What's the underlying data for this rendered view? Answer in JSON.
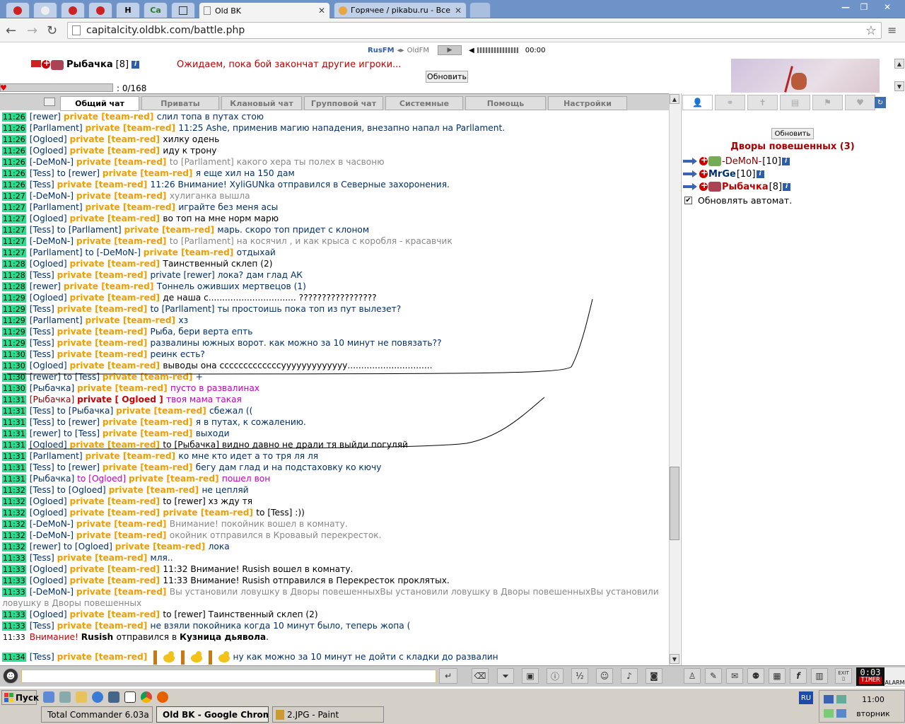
{
  "browser": {
    "tabs": [
      {
        "title": "Old BK",
        "active": true
      },
      {
        "title": "Горячее / pikabu.ru - Все",
        "active": false
      }
    ],
    "pinned_tabs": [
      "",
      "",
      "",
      "",
      "H",
      "Ca",
      ""
    ],
    "url": "capitalcity.oldbk.com/battle.php"
  },
  "radio": {
    "station1": "RusFM",
    "station2": "OldFM",
    "time": "00:00"
  },
  "header": {
    "player_name": "Рыбачка",
    "player_level": "[8]",
    "wait_message": "Ожидаем, пока бой закончат другие игроки...",
    "refresh_label": "Обновить",
    "hp": "0/168",
    "hp_fraction": 0
  },
  "chat_tabs": [
    "Общий чат",
    "Приваты",
    "Клановый чат",
    "Групповой чат",
    "Системные",
    "Помощь",
    "Настройки"
  ],
  "chat_lines": [
    {
      "t": "11:26",
      "segs": [
        [
          "[rewer] ",
          "nm"
        ],
        [
          "private [team-red] ",
          "pv"
        ],
        [
          "слил топа в путах стою",
          "c-blue"
        ]
      ]
    },
    {
      "t": "11:26",
      "segs": [
        [
          "[Parllament] ",
          "nm"
        ],
        [
          "private [team-red] ",
          "pv"
        ],
        [
          "11:25 Ashe, применив магию нападения, внезапно напал на Parllament.",
          "c-blue"
        ]
      ]
    },
    {
      "t": "11:26",
      "segs": [
        [
          "[Ogloed] ",
          "nm"
        ],
        [
          "private [team-red] ",
          "pv"
        ],
        [
          "хилку одень",
          "c-black"
        ]
      ]
    },
    {
      "t": "11:26",
      "segs": [
        [
          "[Ogloed] ",
          "nm"
        ],
        [
          "private [team-red] ",
          "pv"
        ],
        [
          "иду к трону",
          "c-black"
        ]
      ]
    },
    {
      "t": "11:26",
      "segs": [
        [
          "[-DeMoN-] ",
          "nm"
        ],
        [
          "private [team-red] ",
          "pv"
        ],
        [
          "to [Parllament] какого хера ты полех в часвоню",
          "c-gray"
        ]
      ]
    },
    {
      "t": "11:26",
      "segs": [
        [
          "[Tess] ",
          "nm"
        ],
        [
          "to [rewer] ",
          "to"
        ],
        [
          "private [team-red] ",
          "pv"
        ],
        [
          "я еще хил на 150 дам",
          "c-blue"
        ]
      ]
    },
    {
      "t": "11:26",
      "segs": [
        [
          "[Tess] ",
          "nm"
        ],
        [
          "private [team-red] ",
          "pv"
        ],
        [
          "11:26 Внимание! XyliGUNka отправился в Северные захоронения.",
          "c-blue"
        ]
      ]
    },
    {
      "t": "11:27",
      "segs": [
        [
          "[-DeMoN-] ",
          "nm"
        ],
        [
          "private [team-red] ",
          "pv"
        ],
        [
          "хулиганка вышла",
          "c-gray"
        ]
      ]
    },
    {
      "t": "11:27",
      "segs": [
        [
          "[Parllament] ",
          "nm"
        ],
        [
          "private [team-red] ",
          "pv"
        ],
        [
          "играйте без меня асы",
          "c-blue"
        ]
      ]
    },
    {
      "t": "11:27",
      "segs": [
        [
          "[Ogloed] ",
          "nm"
        ],
        [
          "private [team-red] ",
          "pv"
        ],
        [
          "во топ на мне норм марю",
          "c-black"
        ]
      ]
    },
    {
      "t": "11:27",
      "segs": [
        [
          "[Tess] ",
          "nm"
        ],
        [
          "to [Parllament] ",
          "to"
        ],
        [
          "private [team-red] ",
          "pv"
        ],
        [
          "марь. скоро топ придет с клоном",
          "c-blue"
        ]
      ]
    },
    {
      "t": "11:27",
      "segs": [
        [
          "[-DeMoN-] ",
          "nm"
        ],
        [
          "private [team-red] ",
          "pv"
        ],
        [
          "to [Parllament] на косячил , и как крыса с коробля - красавчик",
          "c-gray"
        ]
      ]
    },
    {
      "t": "11:27",
      "segs": [
        [
          "[Parllament] ",
          "nm"
        ],
        [
          "to [-DeMoN-] ",
          "to"
        ],
        [
          "private [team-red] ",
          "pv"
        ],
        [
          "отдыхай",
          "c-blue"
        ]
      ]
    },
    {
      "t": "11:28",
      "segs": [
        [
          "[Ogloed] ",
          "nm"
        ],
        [
          "private [team-red] ",
          "pv"
        ],
        [
          "Таинственный склеп (2)",
          "c-black"
        ]
      ]
    },
    {
      "t": "11:28",
      "segs": [
        [
          "[Tess] ",
          "nm"
        ],
        [
          "private [team-red] ",
          "pv"
        ],
        [
          "private [rewer] лока? дам глад АК",
          "c-blue"
        ]
      ]
    },
    {
      "t": "11:28",
      "segs": [
        [
          "[rewer] ",
          "nm"
        ],
        [
          "private [team-red] ",
          "pv"
        ],
        [
          "Тоннель оживших мертвецов (1)",
          "c-blue"
        ]
      ]
    },
    {
      "t": "11:29",
      "segs": [
        [
          "[Ogloed] ",
          "nm"
        ],
        [
          "private [team-red] ",
          "pv"
        ],
        [
          "де наша с................................ ?????????????????",
          "c-black"
        ]
      ]
    },
    {
      "t": "11:29",
      "segs": [
        [
          "[Tess] ",
          "nm"
        ],
        [
          "private [team-red] ",
          "pv"
        ],
        [
          "to [Parllament] ты простоишь пока топ из пут вылезет?",
          "c-blue"
        ]
      ]
    },
    {
      "t": "11:29",
      "segs": [
        [
          "[Parllament] ",
          "nm"
        ],
        [
          "private [team-red] ",
          "pv"
        ],
        [
          "хз",
          "c-blue"
        ]
      ]
    },
    {
      "t": "11:29",
      "segs": [
        [
          "[Tess] ",
          "nm"
        ],
        [
          "private [team-red] ",
          "pv"
        ],
        [
          "Рыба, бери верта епть",
          "c-blue"
        ]
      ]
    },
    {
      "t": "11:29",
      "segs": [
        [
          "[Tess] ",
          "nm"
        ],
        [
          "private [team-red] ",
          "pv"
        ],
        [
          "развалины южных ворот. как можно за 10 минут не повязать??",
          "c-blue"
        ]
      ]
    },
    {
      "t": "11:30",
      "segs": [
        [
          "[Tess] ",
          "nm"
        ],
        [
          "private [team-red] ",
          "pv"
        ],
        [
          "реинк есть?",
          "c-blue"
        ]
      ]
    },
    {
      "t": "11:30",
      "segs": [
        [
          "[Ogloed] ",
          "nm"
        ],
        [
          "private [team-red] ",
          "pv"
        ],
        [
          "выводы она сссссссссссссууууууууууууу...............................",
          "c-black"
        ]
      ]
    },
    {
      "t": "11:30",
      "segs": [
        [
          "[rewer] ",
          "nm"
        ],
        [
          "to [Tess] ",
          "to"
        ],
        [
          "private [team-red] ",
          "pv"
        ],
        [
          "+",
          "c-blue"
        ]
      ]
    },
    {
      "t": "11:30",
      "segs": [
        [
          "[Рыбачка] ",
          "nm"
        ],
        [
          "private [team-red] ",
          "pv"
        ],
        [
          "пусто в развалинах",
          "c-pink"
        ]
      ]
    },
    {
      "t": "11:31",
      "segs": [
        [
          "[Рыбачка] ",
          "nmR"
        ],
        [
          "private [ Ogloed ] ",
          "pvR"
        ],
        [
          "твоя мама такая",
          "c-pink"
        ]
      ]
    },
    {
      "t": "11:31",
      "segs": [
        [
          "[Tess] ",
          "nm"
        ],
        [
          "to [Рыбачка] ",
          "to"
        ],
        [
          "private [team-red] ",
          "pv"
        ],
        [
          "сбежал ((",
          "c-blue"
        ]
      ]
    },
    {
      "t": "11:31",
      "segs": [
        [
          "[Tess] ",
          "nm"
        ],
        [
          "to [rewer] ",
          "to"
        ],
        [
          "private [team-red] ",
          "pv"
        ],
        [
          "я в путах, к сожалению.",
          "c-blue"
        ]
      ]
    },
    {
      "t": "11:31",
      "segs": [
        [
          "[rewer] ",
          "nm"
        ],
        [
          "to [Tess] ",
          "to"
        ],
        [
          "private [team-red] ",
          "pv"
        ],
        [
          "выходи",
          "c-blue"
        ]
      ]
    },
    {
      "t": "11:31",
      "segs": [
        [
          "[Ogloed] ",
          "nm"
        ],
        [
          "private [team-red] ",
          "pv"
        ],
        [
          "to [Рыбачка] видно давно не драли тя выйди погуляй",
          "c-black"
        ]
      ]
    },
    {
      "t": "11:31",
      "segs": [
        [
          "[Parllament] ",
          "nm"
        ],
        [
          "private [team-red] ",
          "pv"
        ],
        [
          "ко мне кто идет а то тря ля ля",
          "c-blue"
        ]
      ]
    },
    {
      "t": "11:31",
      "segs": [
        [
          "[Tess] ",
          "nm"
        ],
        [
          "to [rewer] ",
          "to"
        ],
        [
          "private [team-red] ",
          "pv"
        ],
        [
          "бегу дам глад и на подстаховку ко кючу",
          "c-blue"
        ]
      ]
    },
    {
      "t": "11:31",
      "segs": [
        [
          "[Рыбачка] ",
          "nm"
        ],
        [
          "to [Ogloed] ",
          "toP"
        ],
        [
          "private [team-red] ",
          "pv"
        ],
        [
          "пошел вон",
          "c-pink"
        ]
      ]
    },
    {
      "t": "11:32",
      "segs": [
        [
          "[Tess] ",
          "nm"
        ],
        [
          "to [Ogloed] ",
          "to"
        ],
        [
          "private [team-red] ",
          "pv"
        ],
        [
          "не цепляй",
          "c-blue"
        ]
      ]
    },
    {
      "t": "11:32",
      "segs": [
        [
          "[Ogloed] ",
          "nm"
        ],
        [
          "private [team-red] ",
          "pv"
        ],
        [
          "to [rewer] хз жду тя",
          "c-black"
        ]
      ]
    },
    {
      "t": "11:32",
      "segs": [
        [
          "[Ogloed] ",
          "nm"
        ],
        [
          "private [team-red] ",
          "pv"
        ],
        [
          "private [team-red] ",
          "pv"
        ],
        [
          "to [Tess] :))",
          "c-black"
        ]
      ]
    },
    {
      "t": "11:32",
      "segs": [
        [
          "[-DeMoN-] ",
          "nm"
        ],
        [
          "private [team-red] ",
          "pv"
        ],
        [
          "Внимание! покойник вошел в комнату.",
          "c-gray"
        ]
      ]
    },
    {
      "t": "11:32",
      "segs": [
        [
          "[-DeMoN-] ",
          "nm"
        ],
        [
          "private [team-red] ",
          "pv"
        ],
        [
          "окойник отправился в Кровавый перекресток.",
          "c-gray"
        ]
      ]
    },
    {
      "t": "11:32",
      "segs": [
        [
          "[rewer] ",
          "nm"
        ],
        [
          "to [Ogloed] ",
          "to"
        ],
        [
          "private [team-red] ",
          "pv"
        ],
        [
          "лока",
          "c-blue"
        ]
      ]
    },
    {
      "t": "11:33",
      "segs": [
        [
          "[Tess] ",
          "nm"
        ],
        [
          "private [team-red] ",
          "pv"
        ],
        [
          "мля..",
          "c-blue"
        ]
      ]
    },
    {
      "t": "11:33",
      "segs": [
        [
          "[Ogloed] ",
          "nm"
        ],
        [
          "private [team-red] ",
          "pv"
        ],
        [
          "11:32 Внимание! Rusish вошел в комнату.",
          "c-black"
        ]
      ]
    },
    {
      "t": "11:33",
      "segs": [
        [
          "[Ogloed] ",
          "nm"
        ],
        [
          "private [team-red] ",
          "pv"
        ],
        [
          "11:33 Внимание! Rusish отправился в Перекресток проклятых.",
          "c-black"
        ]
      ]
    },
    {
      "t": "11:33",
      "wrap": true,
      "segs": [
        [
          "[-DeMoN-] ",
          "nm"
        ],
        [
          "private [team-red] ",
          "pv"
        ],
        [
          "Вы установили ловушку в Дворы повешенныхВы установили ловушку в Дворы повешенныхВы установили ловушку в Дворы повешенных",
          "c-gray"
        ]
      ]
    },
    {
      "t": "11:33",
      "segs": [
        [
          "[Ogloed] ",
          "nm"
        ],
        [
          "private [team-red] ",
          "pv"
        ],
        [
          "to [rewer] Таинственный склеп (2)",
          "c-black"
        ]
      ]
    },
    {
      "t": "11:33",
      "segs": [
        [
          "[Tess] ",
          "nm"
        ],
        [
          "private [team-red] ",
          "pv"
        ],
        [
          "не взяли покойника когда 10 минут было, теперь жопа (",
          "c-blue"
        ]
      ]
    },
    {
      "t": "11:33",
      "plain": true,
      "segs": [
        [
          "Внимание! ",
          "c-sys"
        ],
        [
          "Rusish ",
          "bold"
        ],
        [
          "отправился в ",
          "c-black"
        ],
        [
          "Кузница дьявола",
          "bold"
        ],
        [
          ".",
          "c-black"
        ]
      ]
    },
    {
      "t": "11:34",
      "big": true,
      "segs": [
        [
          "[Tess] ",
          "nm"
        ],
        [
          "private [team-red] ",
          "pv"
        ],
        [
          "__DUCKS__",
          "x"
        ],
        [
          "ну как можно за 10 минут не дойти с кладки до развалин",
          "c-blue"
        ]
      ]
    }
  ],
  "right_panel": {
    "refresh_label": "Обновить",
    "location_title": "Дворы повешенных (3)",
    "players": [
      {
        "name": "-DeMoN-",
        "level": "[10]",
        "color": "#8a0000"
      },
      {
        "name": "MrGe",
        "level": "[10]",
        "color": "#00306c"
      },
      {
        "name": "Рыбачка",
        "level": "[8]",
        "color": "#c00000"
      }
    ],
    "auto_update_label": "Обновлять автомат.",
    "auto_update_checked": true
  },
  "bottom": {
    "clock": "0:03",
    "timer_label": "TIMER",
    "alarm_label": "ALARM",
    "exit_label": "EXIT"
  },
  "taskbar": {
    "start_label": "Пуск",
    "tasks": [
      {
        "title": "Total Commander 6.03a ...",
        "active": false
      },
      {
        "title": "Old BK - Google Chrome",
        "active": true
      },
      {
        "title": "2.JPG - Paint",
        "active": false
      }
    ],
    "lang": "RU",
    "time": "11:00",
    "day": "вторник"
  }
}
